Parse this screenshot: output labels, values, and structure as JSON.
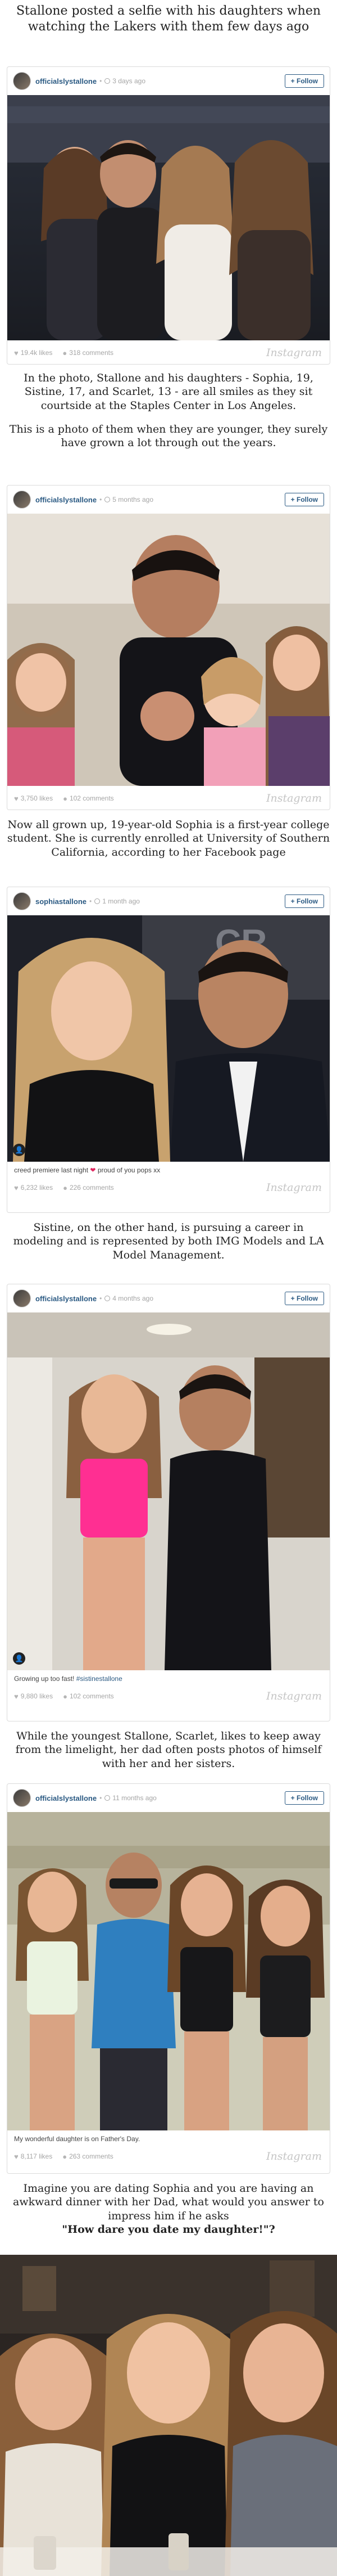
{
  "captions": {
    "c1": "Stallone posted a selfie with his daughters when watching the Lakers with them few days ago",
    "c2a": "In the photo, Stallone and his daughters - Sophia, 19, Sistine, 17, and Scarlet, 13 - are all smiles as they sit courtside at the Staples Center in Los Angeles.",
    "c2b": "This is a photo of them when they are younger, they surely have grown a lot through out the years.",
    "c3": "Now all grown up, 19-year-old Sophia is a first-year college student. She is currently enrolled at University of Southern California, according to her Facebook page",
    "c4": "Sistine, on the other hand, is pursuing a career in modeling and is represented by both IMG Models and LA Model Management.",
    "c5": "While the youngest Stallone, Scarlet, likes to keep away from the limelight, her dad often posts photos of himself with her and her sisters.",
    "c6": "Imagine you are dating Sophia and you are having an awkward dinner with her Dad, what would you answer to impress him if he asks",
    "c6q": "\"How dare you date my daughter!\"?"
  },
  "posts": [
    {
      "user": "officialslystallone",
      "time": "3 days ago",
      "follow": "+ Follow",
      "likes": "19.4k likes",
      "comments": "318 comments",
      "caption": "",
      "brand": "Instagram"
    },
    {
      "user": "officialslystallone",
      "time": "5 months ago",
      "follow": "+ Follow",
      "likes": "3,750 likes",
      "comments": "102 comments",
      "caption": "",
      "brand": "Instagram"
    },
    {
      "user": "sophiastallone",
      "time": "1 month ago",
      "follow": "+ Follow",
      "likes": "6,232 likes",
      "comments": "226 comments",
      "caption": "creed premiere last night",
      "caption_tail": "proud of you pops xx",
      "brand": "Instagram"
    },
    {
      "user": "officialslystallone",
      "time": "4 months ago",
      "follow": "+ Follow",
      "likes": "9,880 likes",
      "comments": "102 comments",
      "caption": "Growing up too fast!",
      "caption_tag": "#sistinestallone",
      "brand": "Instagram"
    },
    {
      "user": "officialslystallone",
      "time": "11 months ago",
      "follow": "+ Follow",
      "likes": "8,117 likes",
      "comments": "263 comments",
      "caption": "My wonderful daughter is on Father's Day.",
      "brand": "Instagram"
    }
  ],
  "colors": {
    "link": "#2b5a83",
    "meta": "#a5a5a5",
    "border": "#dbdbdb"
  },
  "icons": [
    "clock-icon",
    "heart-icon",
    "comment-icon",
    "person-tag-icon",
    "heart-emoji-icon"
  ]
}
